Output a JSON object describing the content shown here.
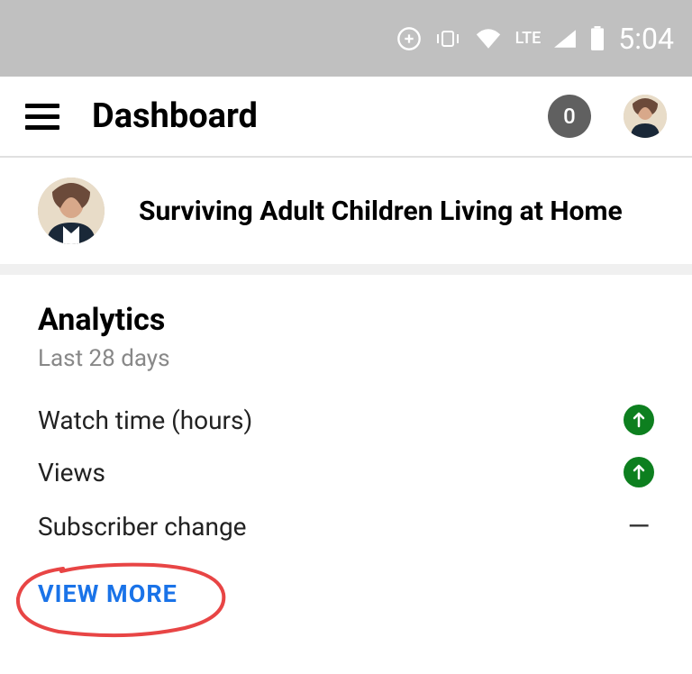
{
  "status_bar": {
    "time": "5:04",
    "network_label": "LTE"
  },
  "header": {
    "title": "Dashboard",
    "notification_count": "0"
  },
  "video": {
    "title": "Surviving Adult Children Living at Home"
  },
  "analytics": {
    "title": "Analytics",
    "subtitle": "Last 28 days",
    "metrics": [
      {
        "label": "Watch time (hours)",
        "trend": "up"
      },
      {
        "label": "Views",
        "trend": "up"
      },
      {
        "label": "Subscriber change",
        "trend": "none"
      }
    ],
    "view_more": "VIEW MORE"
  }
}
